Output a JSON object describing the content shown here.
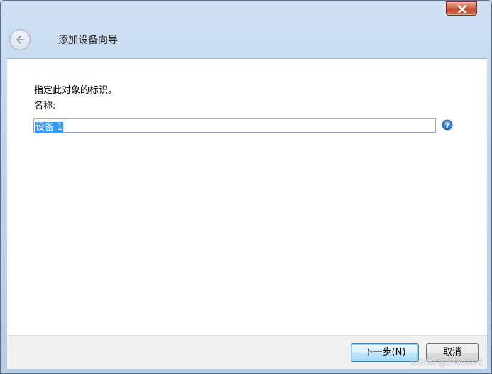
{
  "window": {
    "title": "添加设备向导"
  },
  "titlebar": {
    "close_icon": "close-icon",
    "back_icon": "back-arrow-icon"
  },
  "form": {
    "instruction": "指定此对象的标识。",
    "name_label": "名称:",
    "name_value": "设备 1",
    "help_icon": "help-icon"
  },
  "footer": {
    "next_label": "下一步(N)",
    "cancel_label": "取消"
  },
  "watermark": "CSDN @zhouwl72",
  "colors": {
    "selection": "#3399ff",
    "close_button": "#c24b2c",
    "default_button_border": "#3c7fb1"
  }
}
